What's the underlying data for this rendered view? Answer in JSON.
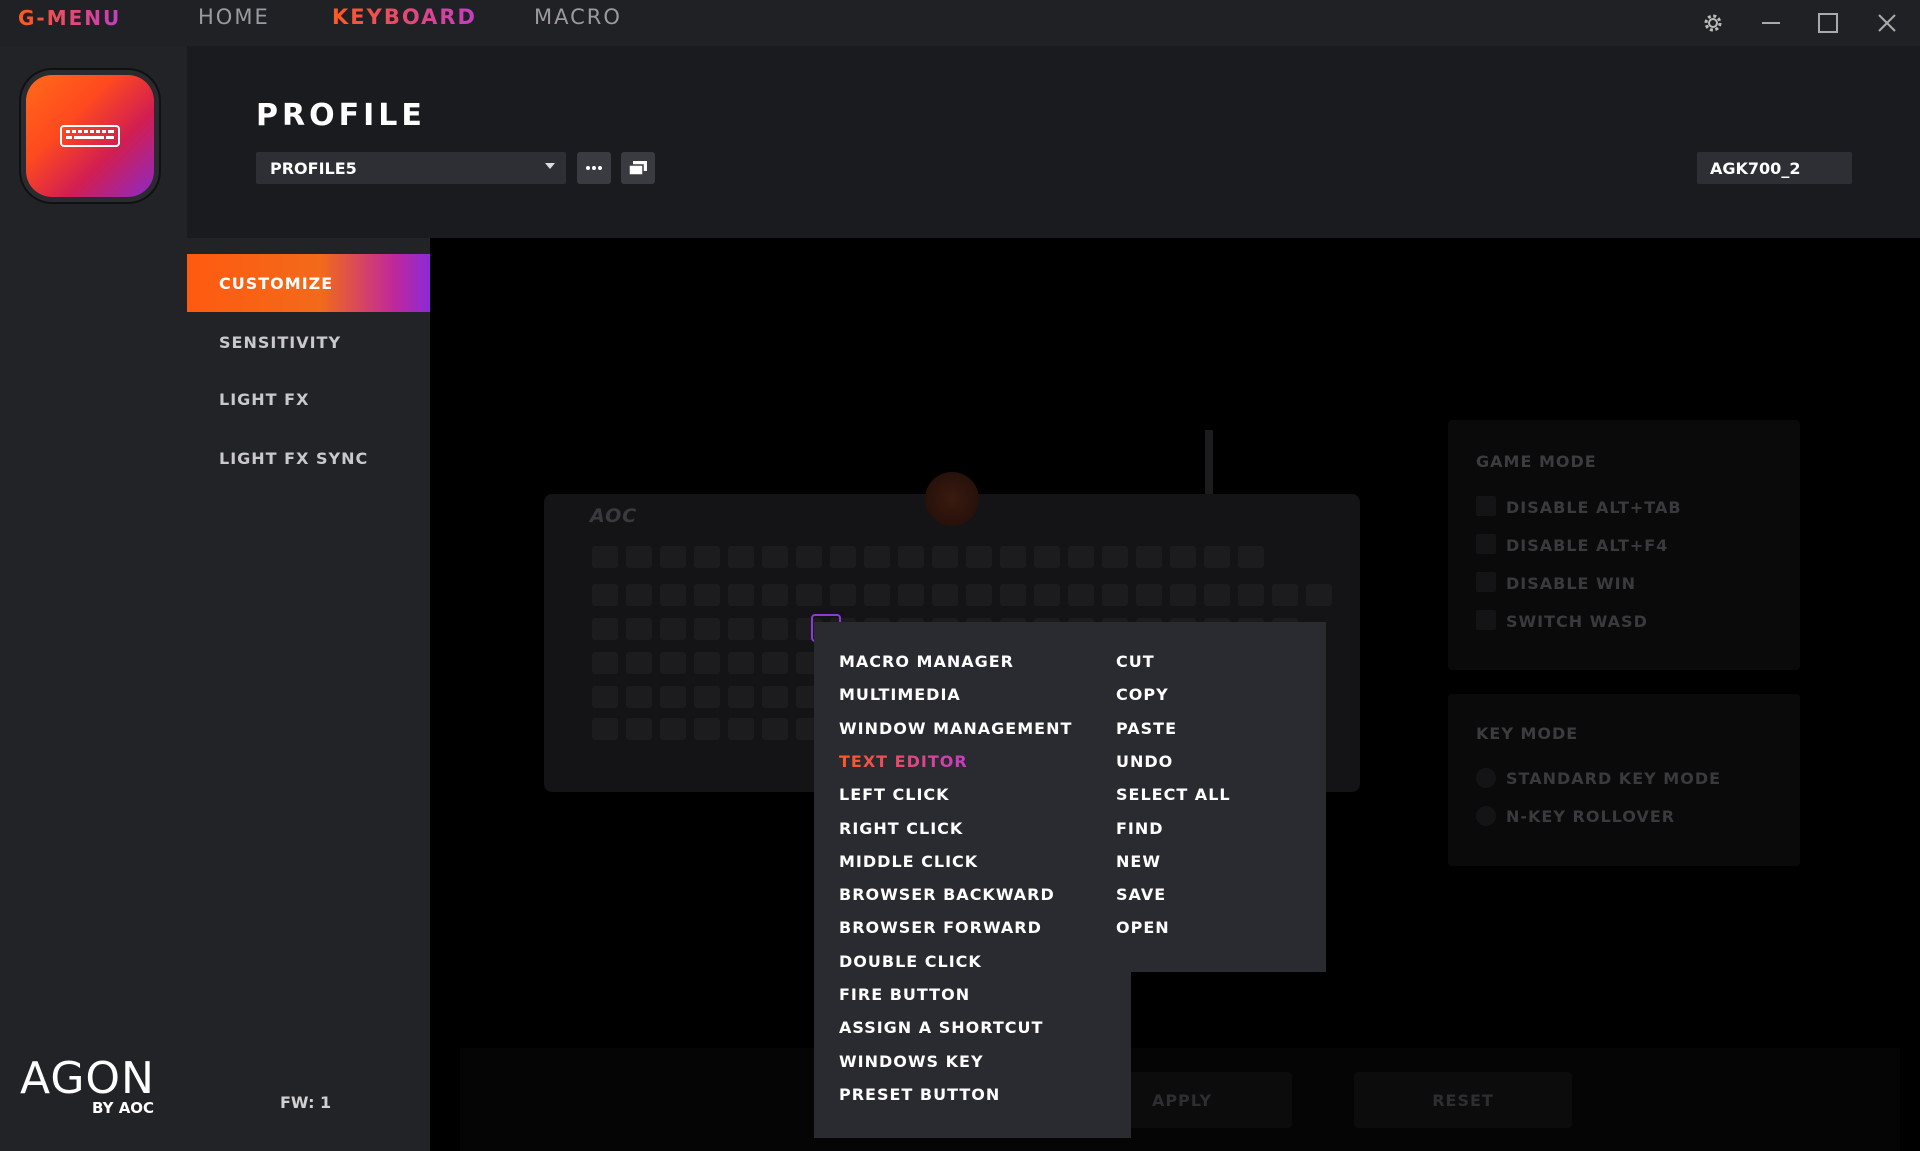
{
  "titlebar": {
    "brand": "G-MENU",
    "nav": [
      "HOME",
      "KEYBOARD",
      "MACRO"
    ],
    "active_nav": "KEYBOARD"
  },
  "header": {
    "title": "PROFILE",
    "profile_value": "PROFILE5",
    "device": "AGK700_2"
  },
  "sidebar": {
    "items": [
      "CUSTOMIZE",
      "SENSITIVITY",
      "LIGHT FX",
      "LIGHT FX SYNC"
    ],
    "active": "CUSTOMIZE",
    "fw": "FW: 1",
    "brand_main": "AGON",
    "brand_sub": "BY AOC"
  },
  "keyboard": {
    "logo": "AOC"
  },
  "game_mode": {
    "title": "GAME MODE",
    "options": [
      "DISABLE ALT+TAB",
      "DISABLE ALT+F4",
      "DISABLE WIN",
      "SWITCH WASD"
    ]
  },
  "key_mode": {
    "title": "KEY MODE",
    "options": [
      "STANDARD KEY MODE",
      "N-KEY ROLLOVER"
    ]
  },
  "actions": {
    "apply": "APPLY",
    "reset": "RESET"
  },
  "context_menu": {
    "main": [
      "MACRO MANAGER",
      "MULTIMEDIA",
      "WINDOW MANAGEMENT",
      "TEXT EDITOR",
      "LEFT CLICK",
      "RIGHT CLICK",
      "MIDDLE CLICK",
      "BROWSER BACKWARD",
      "BROWSER FORWARD",
      "DOUBLE CLICK",
      "FIRE BUTTON",
      "ASSIGN A SHORTCUT",
      "WINDOWS KEY",
      "PRESET BUTTON"
    ],
    "active": "TEXT EDITOR",
    "submenu": [
      "CUT",
      "COPY",
      "PASTE",
      "UNDO",
      "SELECT ALL",
      "FIND",
      "NEW",
      "SAVE",
      "OPEN"
    ]
  },
  "colors": {
    "accent_start": "#ff5a1f",
    "accent_end": "#c43cc6",
    "background": "#000000",
    "panel": "#222327"
  },
  "icons": [
    "settings-gear-icon",
    "minimize-icon",
    "maximize-icon",
    "close-icon",
    "more-options-icon",
    "copy-profile-icon",
    "keyboard-icon"
  ]
}
